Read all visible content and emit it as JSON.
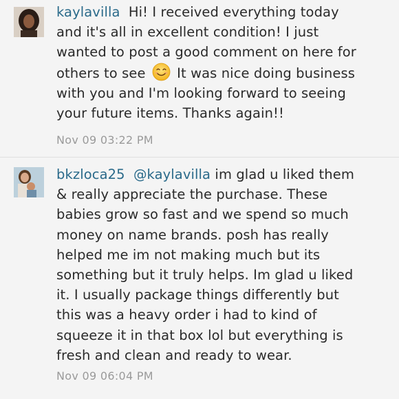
{
  "comments": [
    {
      "username": "kaylavilla",
      "text_before_emoji": "Hi! I received everything today and it's all in excellent condition! I just wanted to post a good comment on here for others to see",
      "emoji": "smiling-face-emoji",
      "text_after_emoji": "It was nice doing business with you and I'm looking forward to seeing your future items. Thanks again!!",
      "timestamp": "Nov 09 03:22 PM"
    },
    {
      "username": "bkzloca25",
      "mention": "@kaylavilla",
      "text": "im glad u liked them & really appreciate the purchase. These babies grow so fast and we spend so much money on name brands. posh has really helped me im not making much but its something but it truly helps. Im glad u liked it. I usually package things differently but this was a heavy order i had to kind of squeeze it in that box lol but everything is fresh and clean and ready to wear.",
      "timestamp": "Nov 09 06:04 PM"
    }
  ],
  "colors": {
    "background": "#f4f4f4",
    "username": "#2a6a8a",
    "body_text": "#2a2a2a",
    "timestamp": "#9a9a9a"
  }
}
